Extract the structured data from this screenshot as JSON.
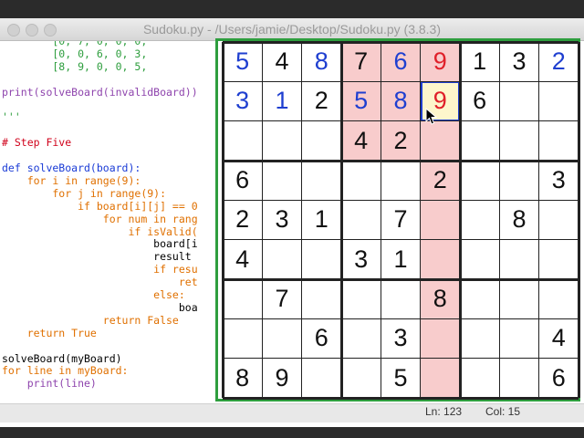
{
  "window": {
    "title": "Sudoku.py - /Users/jamie/Desktop/Sudoku.py (3.8.3)",
    "status": {
      "line": "Ln: 123",
      "col": "Col: 15"
    }
  },
  "code_lines": [
    {
      "text": "        [0, 7, 0, 0, 0,",
      "color": "#2e9e3e"
    },
    {
      "text": "        [0, 0, 6, 0, 3,",
      "color": "#2e9e3e"
    },
    {
      "text": "        [8, 9, 0, 0, 5,",
      "color": "#2e9e3e"
    },
    {
      "text": "",
      "color": "#000000"
    },
    {
      "text": "print(solveBoard(invalidBoard))",
      "color": "#8e44ad"
    },
    {
      "text": "",
      "color": "#000000"
    },
    {
      "text": "'''",
      "color": "#2e9e3e"
    },
    {
      "text": "",
      "color": "#000000"
    },
    {
      "text": "# Step Five",
      "color": "#d0021b"
    },
    {
      "text": "",
      "color": "#000000"
    },
    {
      "text": "def solveBoard(board):",
      "color": "#1a3bd6"
    },
    {
      "text": "    for i in range(9):",
      "color": "#e07000"
    },
    {
      "text": "        for j in range(9):",
      "color": "#e07000"
    },
    {
      "text": "            if board[i][j] == 0",
      "color": "#e07000"
    },
    {
      "text": "                for num in rang",
      "color": "#e07000"
    },
    {
      "text": "                    if isValid(",
      "color": "#e07000"
    },
    {
      "text": "                        board[i",
      "color": "#000000"
    },
    {
      "text": "                        result",
      "color": "#000000"
    },
    {
      "text": "                        if resu",
      "color": "#e07000"
    },
    {
      "text": "                            ret",
      "color": "#e07000"
    },
    {
      "text": "                        else:",
      "color": "#e07000"
    },
    {
      "text": "                            boa",
      "color": "#000000"
    },
    {
      "text": "                return False",
      "color": "#e07000"
    },
    {
      "text": "    return True",
      "color": "#e07000"
    },
    {
      "text": "",
      "color": "#000000"
    },
    {
      "text": "solveBoard(myBoard)",
      "color": "#000000"
    },
    {
      "text": "for line in myBoard:",
      "color": "#e07000"
    },
    {
      "text": "    print(line)",
      "color": "#8e44ad"
    }
  ],
  "board": {
    "values": [
      [
        "5",
        "4",
        "8",
        "7",
        "6",
        "9",
        "1",
        "3",
        "2"
      ],
      [
        "3",
        "1",
        "2",
        "5",
        "8",
        "9",
        "6",
        "",
        ""
      ],
      [
        "",
        "",
        "",
        "4",
        "2",
        "",
        "",
        "",
        ""
      ],
      [
        "6",
        "",
        "",
        "",
        "",
        "2",
        "",
        "",
        "3"
      ],
      [
        "2",
        "3",
        "1",
        "",
        "7",
        "",
        "",
        "8",
        ""
      ],
      [
        "4",
        "",
        "",
        "3",
        "1",
        "",
        "",
        "",
        ""
      ],
      [
        "",
        "7",
        "",
        "",
        "",
        "8",
        "",
        "",
        ""
      ],
      [
        "",
        "",
        "6",
        "",
        "3",
        "",
        "",
        "",
        "4"
      ],
      [
        "8",
        "9",
        "",
        "",
        "5",
        "",
        "",
        "",
        "6"
      ]
    ],
    "filled_cells": [
      [
        0,
        0
      ],
      [
        0,
        2
      ],
      [
        0,
        4
      ],
      [
        0,
        5
      ],
      [
        0,
        8
      ],
      [
        1,
        0
      ],
      [
        1,
        1
      ],
      [
        1,
        3
      ],
      [
        1,
        4
      ],
      [
        1,
        5
      ]
    ],
    "conflict_cells": [
      [
        0,
        5
      ],
      [
        1,
        5
      ]
    ],
    "highlight_cells": [
      [
        0,
        3
      ],
      [
        0,
        4
      ],
      [
        0,
        5
      ],
      [
        1,
        3
      ],
      [
        1,
        4
      ],
      [
        1,
        5
      ],
      [
        2,
        3
      ],
      [
        2,
        4
      ],
      [
        2,
        5
      ],
      [
        3,
        5
      ],
      [
        4,
        5
      ],
      [
        5,
        5
      ],
      [
        6,
        5
      ],
      [
        7,
        5
      ],
      [
        8,
        5
      ]
    ],
    "selected_cell": [
      1,
      5
    ],
    "colors": {
      "given": "#111111",
      "filled": "#1f3fd0",
      "conflict": "#e0202a",
      "highlight": "#f8cccc",
      "selected": "#fdf6cc",
      "selected_border": "#1f3fd0",
      "frame": "#2e9e3e"
    }
  }
}
